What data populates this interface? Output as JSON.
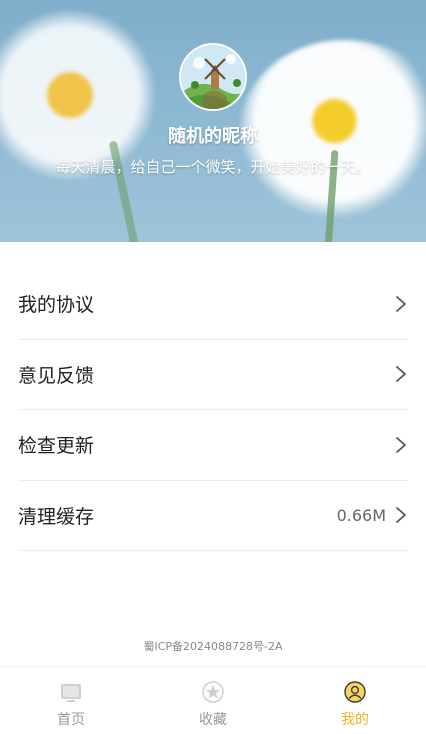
{
  "profile": {
    "nickname": "随机的昵称",
    "motto": "每天清晨，给自己一个微笑，开始美好的一天。"
  },
  "menu": [
    {
      "label": "我的协议",
      "value": ""
    },
    {
      "label": "意见反馈",
      "value": ""
    },
    {
      "label": "检查更新",
      "value": ""
    },
    {
      "label": "清理缓存",
      "value": "0.66M"
    }
  ],
  "footer": {
    "icp": "蜀ICP备2024088728号-2A"
  },
  "tabbar": {
    "active": "我的",
    "accent_color": "#f2b51e",
    "items": [
      {
        "label": "首页",
        "icon": "home-screen-icon"
      },
      {
        "label": "收藏",
        "icon": "star-icon"
      },
      {
        "label": "我的",
        "icon": "profile-icon"
      }
    ]
  }
}
